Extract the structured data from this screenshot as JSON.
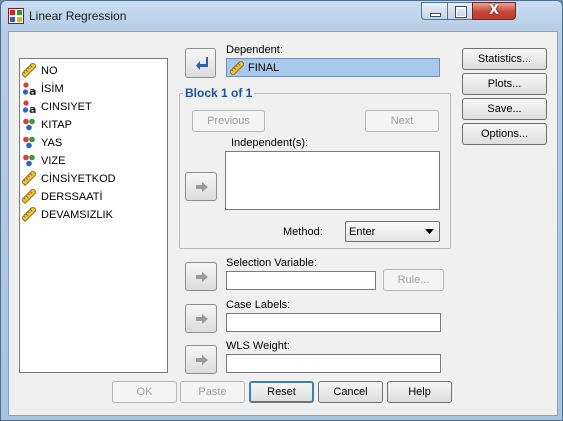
{
  "window": {
    "title": "Linear Regression",
    "close_glyph": "X"
  },
  "variables": [
    {
      "name": "NO",
      "icon": "scale-ruler-icon"
    },
    {
      "name": "İSİM",
      "icon": "nominal-string-icon"
    },
    {
      "name": "CINSIYET",
      "icon": "nominal-string-icon"
    },
    {
      "name": "KITAP",
      "icon": "nominal-balls-icon"
    },
    {
      "name": "YAS",
      "icon": "nominal-balls-icon"
    },
    {
      "name": "VIZE",
      "icon": "nominal-balls-icon"
    },
    {
      "name": "CİNSİYETKOD",
      "icon": "scale-ruler-icon"
    },
    {
      "name": "DERSSAATİ",
      "icon": "scale-ruler-icon"
    },
    {
      "name": "DEVAMSIZLIK",
      "icon": "scale-ruler-icon"
    }
  ],
  "dependent": {
    "label": "Dependent:",
    "value": "FINAL"
  },
  "block": {
    "title": "Block 1 of 1",
    "previous": "Previous",
    "next": "Next"
  },
  "independents": {
    "label": "Independent(s):"
  },
  "method": {
    "label": "Method:",
    "value": "Enter"
  },
  "selection": {
    "label": "Selection Variable:",
    "rule": "Rule..."
  },
  "case_labels": {
    "label": "Case Labels:"
  },
  "wls": {
    "label": "WLS Weight:"
  },
  "side_buttons": [
    "Statistics...",
    "Plots...",
    "Save...",
    "Options..."
  ],
  "bottom_buttons": {
    "ok": "OK",
    "paste": "Paste",
    "reset": "Reset",
    "cancel": "Cancel",
    "help": "Help"
  },
  "colors": {
    "accent": "#1c4f9c",
    "selected_field": "#a8c9eb"
  }
}
